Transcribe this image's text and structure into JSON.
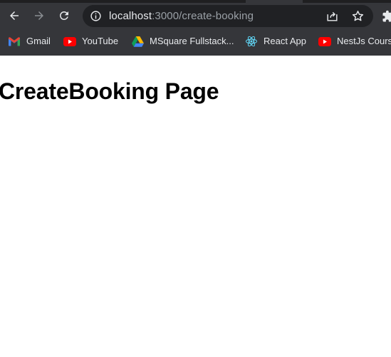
{
  "browser": {
    "url_host": "localhost",
    "url_path": ":3000/create-booking",
    "bookmarks": [
      {
        "label": "Gmail",
        "icon": "gmail-icon"
      },
      {
        "label": "YouTube",
        "icon": "youtube-icon"
      },
      {
        "label": "MSquare Fullstack...",
        "icon": "google-drive-icon"
      },
      {
        "label": "React App",
        "icon": "react-icon"
      },
      {
        "label": "NestJs Course",
        "icon": "youtube-icon"
      }
    ],
    "colors": {
      "chrome_bg": "#35363a",
      "omnibox_bg": "#202124",
      "text": "#e8eaed",
      "muted_text": "#9aa0a6"
    }
  },
  "page": {
    "title": "CreateBooking Page"
  }
}
